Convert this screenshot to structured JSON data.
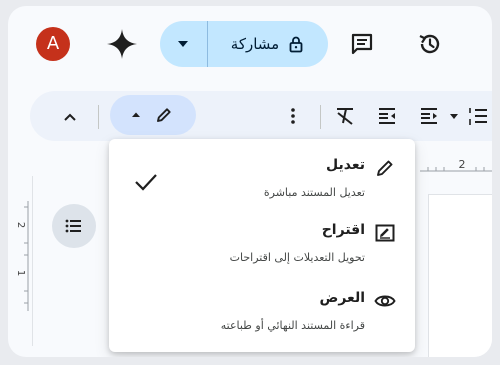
{
  "header": {
    "avatar_letter": "A",
    "share_label": "مشاركة",
    "icons": [
      "gemini-sparkle-icon",
      "caret-down-icon",
      "lock-icon",
      "comment-icon",
      "history-icon"
    ]
  },
  "toolbar": {
    "icons": [
      "chevron-up-icon",
      "pencil-icon",
      "more-vert-icon",
      "clear-format-icon",
      "indent-increase-icon",
      "indent-decrease-icon",
      "numbered-list-icon"
    ]
  },
  "ruler": {
    "h_number": "2",
    "v_numbers": [
      "2",
      "1"
    ]
  },
  "menu": {
    "items": [
      {
        "title": "تعديل",
        "desc": "تعديل المستند مباشرة",
        "icon": "pencil-icon",
        "checked": true
      },
      {
        "title": "اقتراح",
        "desc": "تحويل التعديلات إلى اقتراحات",
        "icon": "suggest-icon",
        "checked": false
      },
      {
        "title": "العرض",
        "desc": "قراءة المستند النهائي أو طباعته",
        "icon": "eye-icon",
        "checked": false
      }
    ]
  },
  "colors": {
    "avatar": "#c5311b",
    "share_pill": "#c2e7ff",
    "toolbar": "#edf2fa",
    "mode_button": "#d3e3fd"
  }
}
